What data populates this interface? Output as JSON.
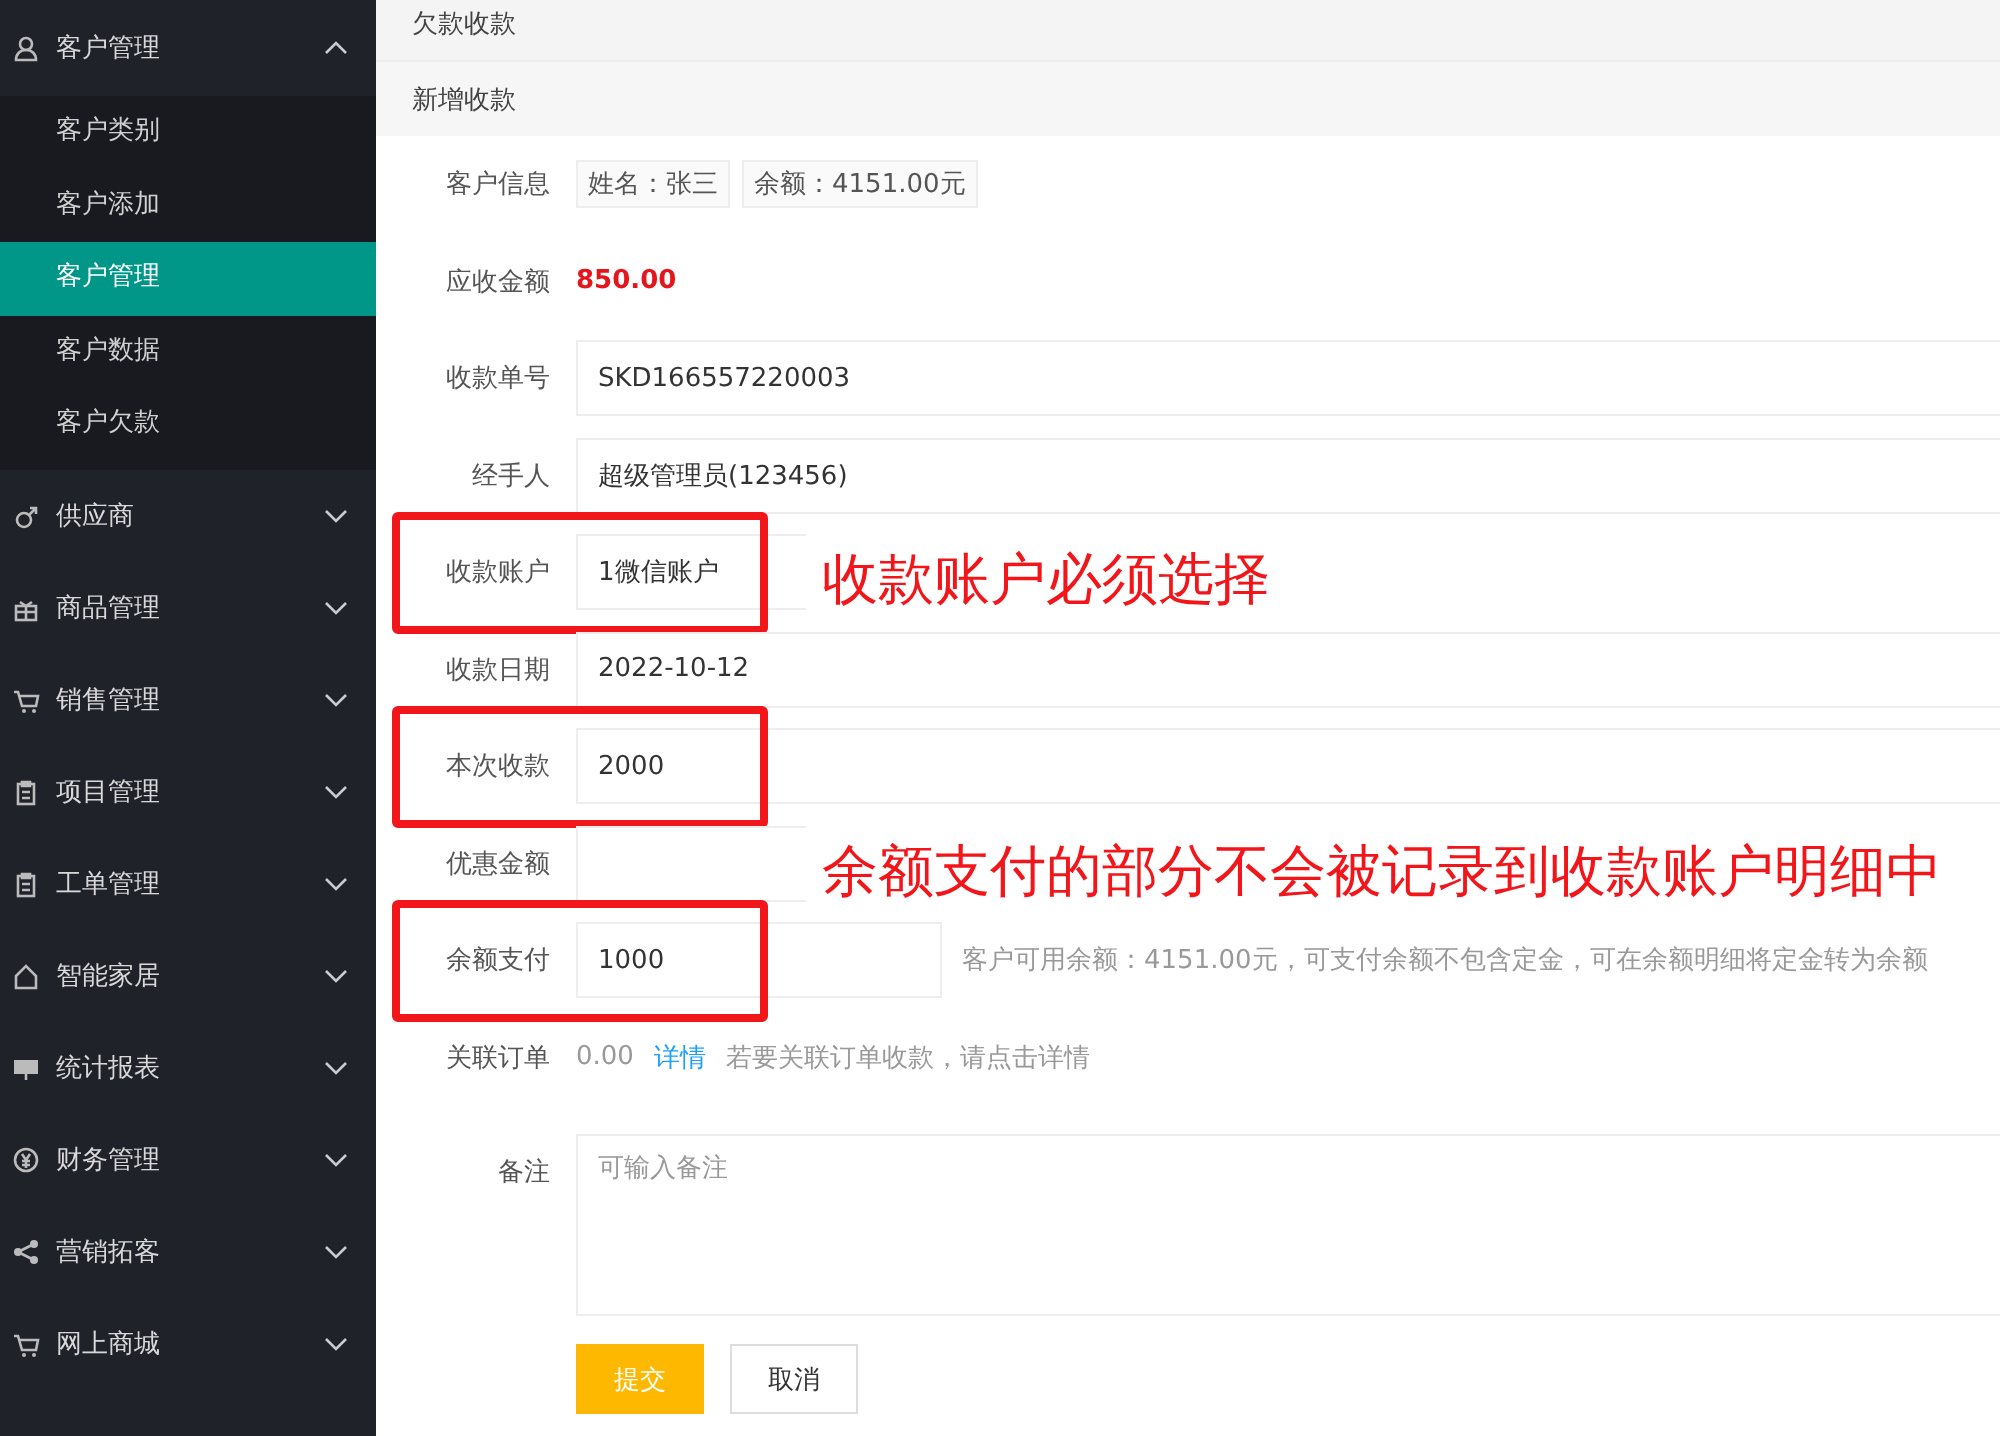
{
  "sidebar": {
    "items": [
      {
        "label": "客户管理",
        "expanded": true,
        "children": [
          {
            "label": "客户类别",
            "selected": false
          },
          {
            "label": "客户添加",
            "selected": false
          },
          {
            "label": "客户管理",
            "selected": true
          },
          {
            "label": "客户数据",
            "selected": false
          },
          {
            "label": "客户欠款",
            "selected": false
          }
        ]
      },
      {
        "label": "供应商",
        "expanded": false
      },
      {
        "label": "商品管理",
        "expanded": false
      },
      {
        "label": "销售管理",
        "expanded": false
      },
      {
        "label": "项目管理",
        "expanded": false
      },
      {
        "label": "工单管理",
        "expanded": false
      },
      {
        "label": "智能家居",
        "expanded": false
      },
      {
        "label": "统计报表",
        "expanded": false
      },
      {
        "label": "财务管理",
        "expanded": false
      },
      {
        "label": "营销拓客",
        "expanded": false
      },
      {
        "label": "网上商城",
        "expanded": false
      }
    ]
  },
  "breadcrumb": "欠款收款",
  "panel_title": "新增收款",
  "form": {
    "rows": [
      {
        "label": "客户信息",
        "kind": "tags",
        "highlighted": false,
        "tags": [
          "姓名：张三",
          "余额：4151.00元"
        ]
      },
      {
        "label": "应收金额",
        "kind": "amount",
        "highlighted": false,
        "value": "850.00"
      },
      {
        "label": "收款单号",
        "kind": "input",
        "highlighted": false,
        "value": "SKD166557220003"
      },
      {
        "label": "经手人",
        "kind": "input",
        "highlighted": false,
        "value": "超级管理员(123456)"
      },
      {
        "label": "收款账户",
        "kind": "input",
        "highlighted": true,
        "value": "1微信账户",
        "note": "收款账户必须选择"
      },
      {
        "label": "收款日期",
        "kind": "input",
        "highlighted": false,
        "value": "2022-10-12"
      },
      {
        "label": "本次收款",
        "kind": "input",
        "highlighted": true,
        "value": "2000"
      },
      {
        "label": "优惠金额",
        "kind": "input",
        "highlighted": false,
        "note": "余额支付的部分不会被记录到收款账户明细中"
      },
      {
        "label": "余额支付",
        "kind": "input-short",
        "highlighted": true,
        "value": "1000",
        "hint": "客户可用余额：4151.00元，可支付余额不包含定金，可在余额明细将定金转为余额"
      },
      {
        "label": "关联订单",
        "kind": "link",
        "highlighted": false,
        "value": "0.00",
        "link": "详情",
        "hint": "若要关联订单收款，请点击详情"
      },
      {
        "label": "备注",
        "kind": "textarea",
        "highlighted": false,
        "placeholder": "可输入备注"
      }
    ],
    "buttons": [
      {
        "label": "提交",
        "kind": "primary"
      },
      {
        "label": "取消",
        "kind": "default"
      }
    ]
  }
}
